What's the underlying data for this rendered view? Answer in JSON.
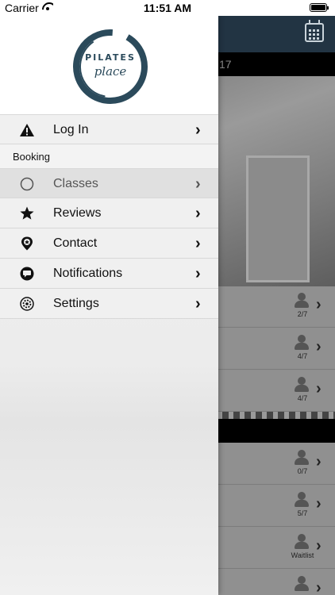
{
  "status_bar": {
    "carrier": "Carrier",
    "time": "11:51 AM"
  },
  "drawer": {
    "logo": {
      "line1": "PILATES",
      "line2": "place"
    },
    "items_top": [
      {
        "label": "Log In",
        "icon": "warning-icon"
      }
    ],
    "section_title": "Booking",
    "items": [
      {
        "label": "Classes",
        "icon": "circle-icon",
        "active": true
      },
      {
        "label": "Reviews",
        "icon": "star-icon"
      },
      {
        "label": "Contact",
        "icon": "location-pin-icon"
      },
      {
        "label": "Notifications",
        "icon": "chat-bubble-icon"
      },
      {
        "label": "Settings",
        "icon": "gear-icon"
      }
    ]
  },
  "background": {
    "date_bar_partial": "17",
    "rows": [
      {
        "count": "2/7"
      },
      {
        "count": "4/7"
      },
      {
        "count": "4/7"
      },
      {
        "count": "0/7"
      },
      {
        "count": "5/7"
      },
      {
        "count": "Waitlist"
      },
      {
        "count": ""
      }
    ]
  },
  "colors": {
    "navbar": "#223443",
    "brand": "#2b4a5b"
  }
}
